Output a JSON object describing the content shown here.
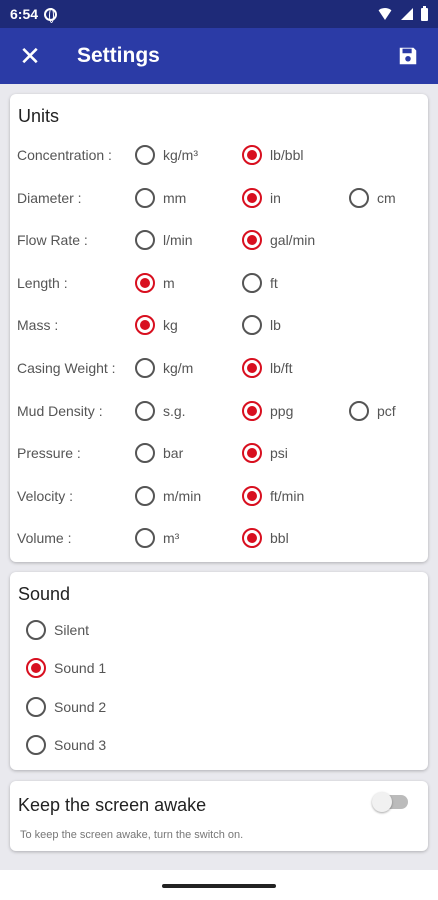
{
  "status_bar": {
    "time": "6:54"
  },
  "app_bar": {
    "title": "Settings"
  },
  "units": {
    "title": "Units",
    "rows": [
      {
        "label": "Concentration :",
        "options": [
          "kg/m³",
          "lb/bbl"
        ],
        "selected": 1
      },
      {
        "label": "Diameter :",
        "options": [
          "mm",
          "in",
          "cm"
        ],
        "selected": 1
      },
      {
        "label": "Flow Rate :",
        "options": [
          "l/min",
          "gal/min"
        ],
        "selected": 1
      },
      {
        "label": "Length :",
        "options": [
          "m",
          "ft"
        ],
        "selected": 0
      },
      {
        "label": "Mass :",
        "options": [
          "kg",
          "lb"
        ],
        "selected": 0
      },
      {
        "label": "Casing Weight :",
        "options": [
          "kg/m",
          "lb/ft"
        ],
        "selected": 1
      },
      {
        "label": "Mud Density :",
        "options": [
          "s.g.",
          "ppg",
          "pcf"
        ],
        "selected": 1
      },
      {
        "label": "Pressure :",
        "options": [
          "bar",
          "psi"
        ],
        "selected": 1
      },
      {
        "label": "Velocity :",
        "options": [
          "m/min",
          "ft/min"
        ],
        "selected": 1
      },
      {
        "label": "Volume :",
        "options": [
          "m³",
          "bbl"
        ],
        "selected": 1
      }
    ]
  },
  "sound": {
    "title": "Sound",
    "options": [
      "Silent",
      "Sound 1",
      "Sound 2",
      "Sound 3"
    ],
    "selected": 1
  },
  "awake": {
    "title": "Keep the screen awake",
    "description": "To keep the screen awake, turn the switch on.",
    "enabled": false
  },
  "colors": {
    "primary": "#2b3ba6",
    "status_bar": "#1e2a78",
    "accent": "#d80f1f"
  }
}
